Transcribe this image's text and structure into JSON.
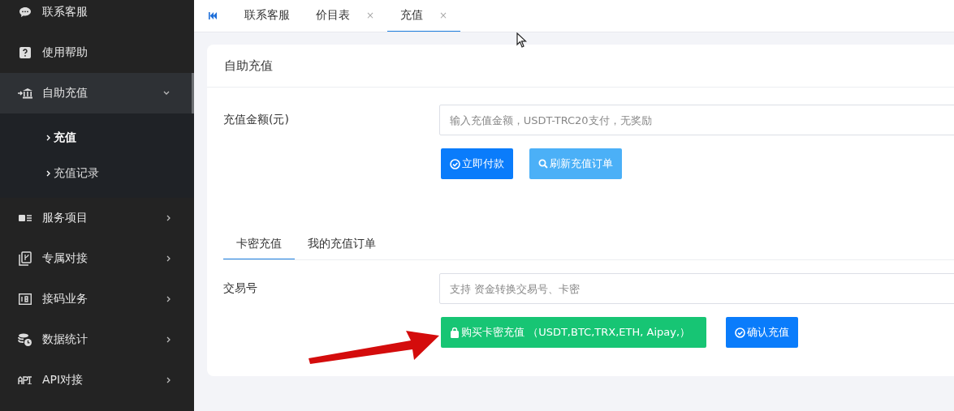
{
  "sidebar": {
    "items": [
      {
        "label": "联系客服",
        "selected": false
      },
      {
        "label": "使用帮助",
        "selected": false
      },
      {
        "label": "自助充值",
        "selected": true,
        "expanded": true,
        "children": [
          {
            "label": "充值",
            "selected": true
          },
          {
            "label": "充值记录",
            "selected": false
          }
        ]
      },
      {
        "label": "服务项目",
        "selected": false,
        "expanded": false
      },
      {
        "label": "专属对接",
        "selected": false,
        "expanded": false
      },
      {
        "label": "接码业务",
        "selected": false,
        "expanded": false
      },
      {
        "label": "数据统计",
        "selected": false,
        "expanded": false
      },
      {
        "label": "API对接",
        "selected": false,
        "expanded": false
      }
    ]
  },
  "tabs": [
    {
      "label": "联系客服",
      "selected": false
    },
    {
      "label": "价目表",
      "selected": false,
      "close": "×"
    },
    {
      "label": "充值",
      "selected": true,
      "close": "×"
    }
  ],
  "card": {
    "title": "自助充值",
    "amount_form": {
      "label": "充值金额(元)",
      "placeholder": "输入充值金额，USDT-TRC20支付，无奖励",
      "buttons": [
        "立即付款",
        "刷新充值订单"
      ]
    },
    "inner_tabs": [
      {
        "label": "卡密充值",
        "selected": true
      },
      {
        "label": "我的充值订单",
        "selected": false
      }
    ],
    "code_form": {
      "label": "交易号",
      "placeholder": "支持 资金转换交易号、卡密",
      "buttons": [
        "购买卡密充值 （USDT,BTC,TRX,ETH, Aipay,）",
        "确认充值"
      ]
    }
  }
}
